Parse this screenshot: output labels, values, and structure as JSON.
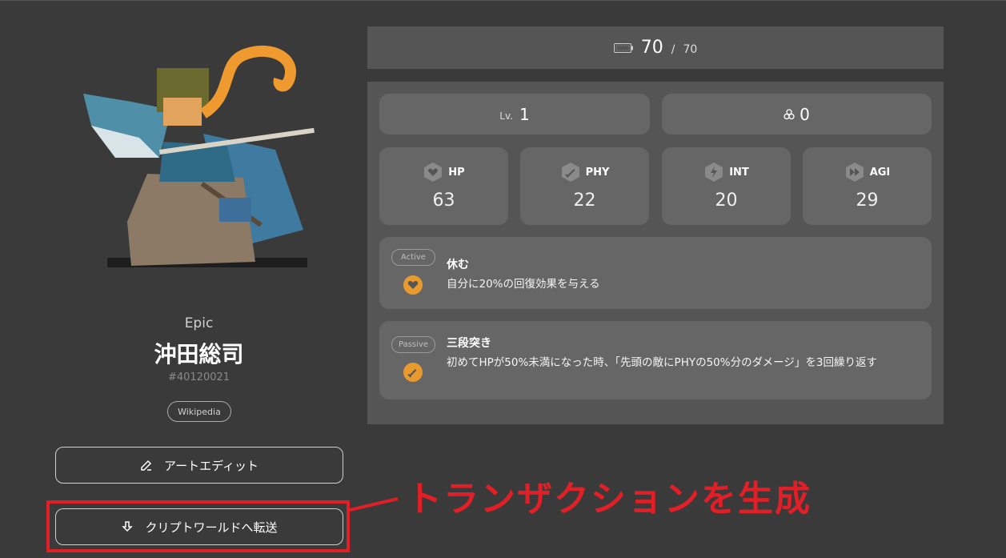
{
  "character": {
    "rarity": "Epic",
    "name": "沖田総司",
    "serial": "#40120021",
    "wiki_label": "Wikipedia"
  },
  "actions": {
    "art_edit_label": "アートエディット",
    "transfer_label": "クリプトワールドへ転送"
  },
  "annotation": {
    "callout_text": "トランザクションを生成",
    "color": "#e21f26"
  },
  "stamina": {
    "current": "70",
    "separator": "/",
    "max": "70"
  },
  "level": {
    "label": "Lv.",
    "value": "1"
  },
  "token": {
    "value": "0"
  },
  "stats": [
    {
      "key": "HP",
      "value": "63",
      "icon": "heart-icon"
    },
    {
      "key": "PHY",
      "value": "22",
      "icon": "sword-icon"
    },
    {
      "key": "INT",
      "value": "20",
      "icon": "lightning-icon"
    },
    {
      "key": "AGI",
      "value": "29",
      "icon": "fast-forward-icon"
    }
  ],
  "skills": [
    {
      "type": "Active",
      "title": "休む",
      "description": "自分に20%の回復効果を与える",
      "icon": "heart-icon"
    },
    {
      "type": "Passive",
      "title": "三段突き",
      "description": "初めてHPが50%未満になった時、「先頭の敵にPHYの50%分のダメージ」を3回繰り返す",
      "icon": "sword-icon"
    }
  ],
  "colors": {
    "background": "#3a3a3a",
    "panel": "#555555",
    "card": "#666666",
    "skill_icon": "#e89a2e"
  }
}
